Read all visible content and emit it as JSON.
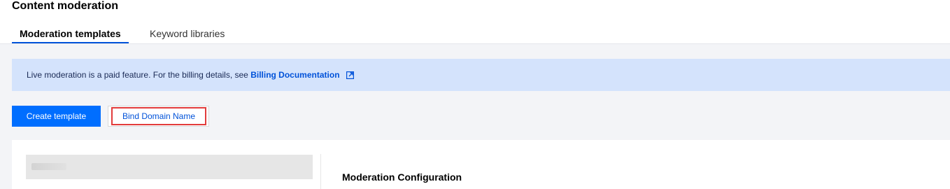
{
  "header": {
    "title": "Content moderation",
    "tabs": [
      {
        "label": "Moderation templates",
        "active": true
      },
      {
        "label": "Keyword libraries",
        "active": false
      }
    ]
  },
  "notice": {
    "text": "Live moderation is a paid feature. For the billing details, see ",
    "link_label": "Billing Documentation",
    "link_icon": "external-link-icon"
  },
  "toolbar": {
    "create_label": "Create template",
    "bind_label": "Bind Domain Name"
  },
  "content": {
    "section_title": "Moderation Configuration"
  },
  "colors": {
    "primary": "#006eff",
    "link": "#0052d9",
    "notice_bg": "#d4e3fc",
    "highlight": "#e23c3c"
  }
}
